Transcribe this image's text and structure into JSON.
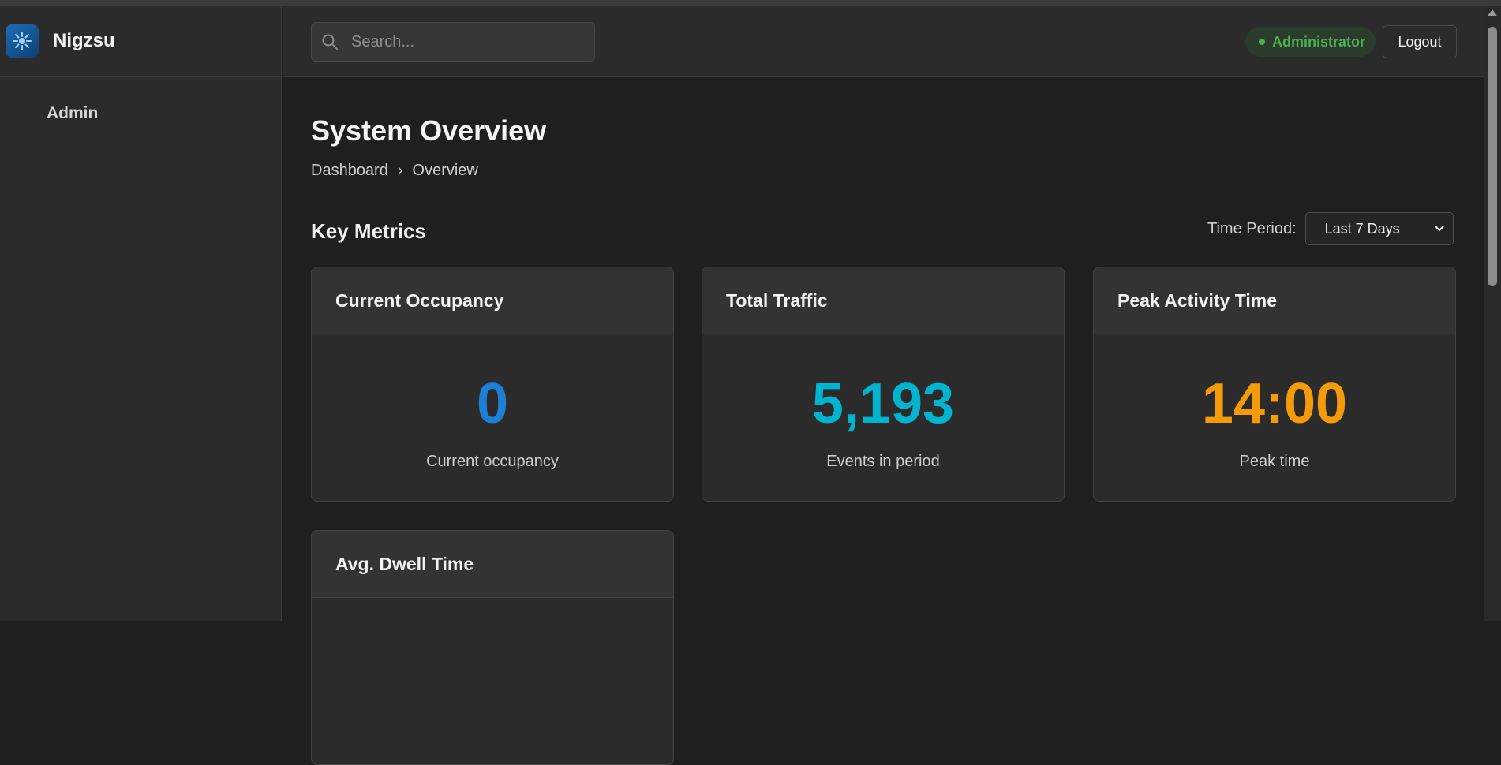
{
  "app": {
    "name": "Nigzsu"
  },
  "sidebar": {
    "items": [
      {
        "label": "Admin"
      }
    ]
  },
  "topbar": {
    "search_placeholder": "Search...",
    "role_badge": "Administrator",
    "role_color": "#4caf50",
    "logout_label": "Logout"
  },
  "page": {
    "title": "System Overview",
    "breadcrumb": [
      "Dashboard",
      "Overview"
    ],
    "breadcrumb_separator": "›",
    "section_title": "Key Metrics",
    "time_period_label": "Time Period:",
    "time_period_value": "Last 7 Days"
  },
  "metrics": [
    {
      "title": "Current Occupancy",
      "value": "0",
      "caption": "Current occupancy",
      "color": "#1e7fd6"
    },
    {
      "title": "Total Traffic",
      "value": "5,193",
      "caption": "Events in period",
      "color": "#00b4cf"
    },
    {
      "title": "Peak Activity Time",
      "value": "14:00",
      "caption": "Peak time",
      "color": "#f59b0a"
    },
    {
      "title": "Avg. Dwell Time",
      "value": "",
      "caption": "",
      "color": "#e6e6e6"
    }
  ]
}
